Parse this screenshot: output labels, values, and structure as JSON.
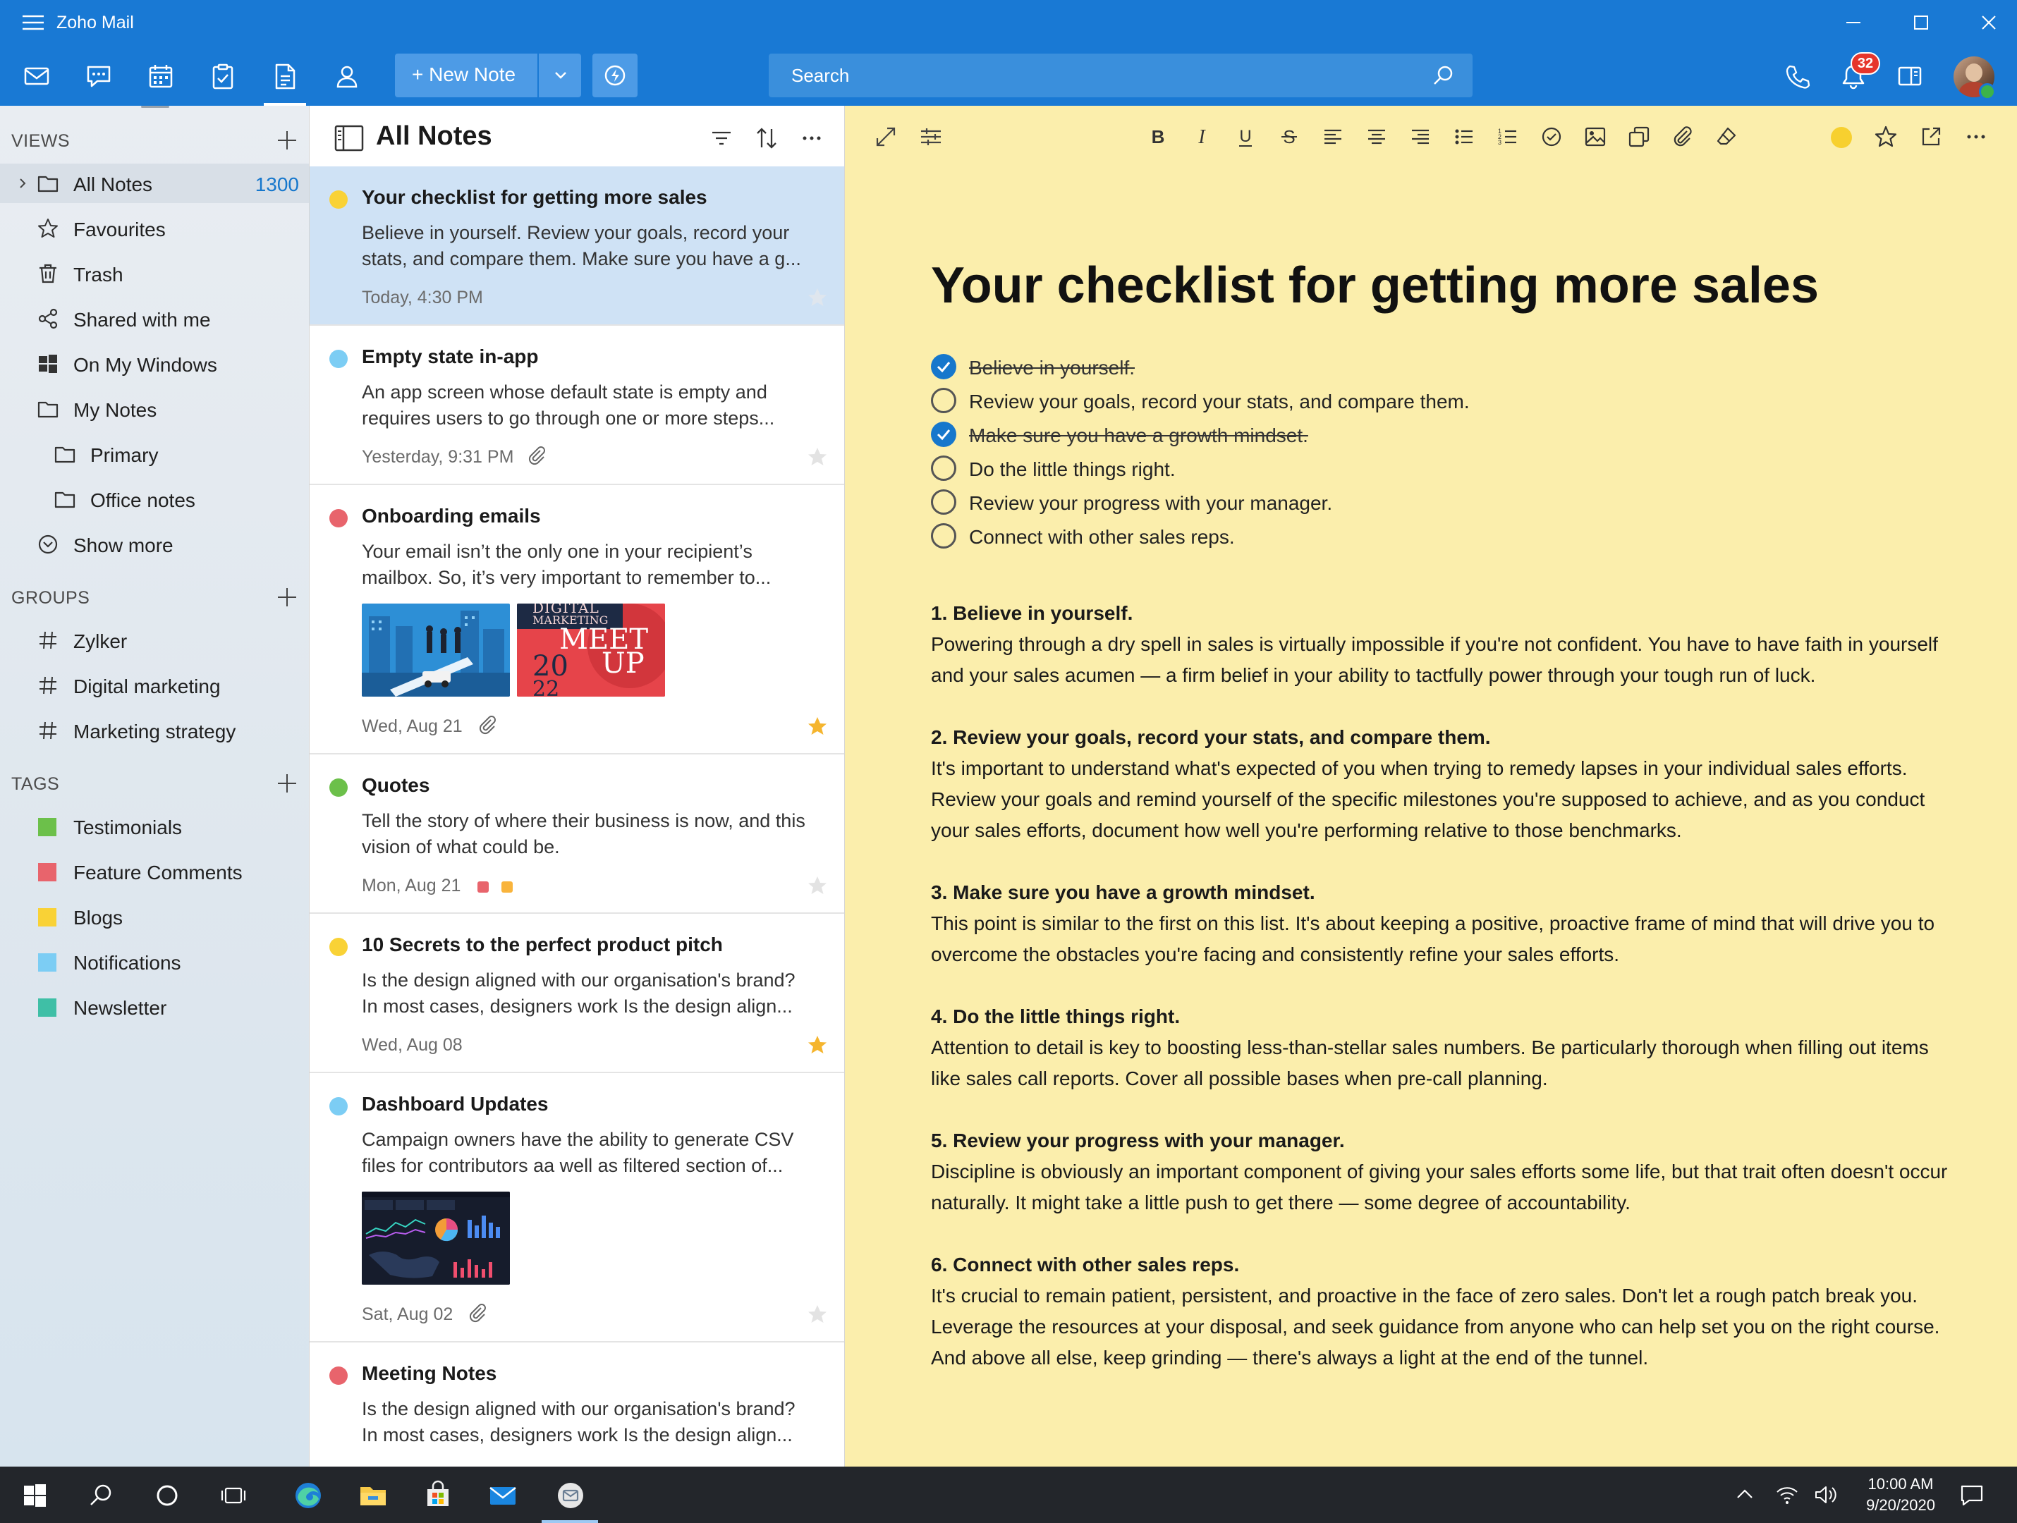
{
  "window": {
    "title": "Zoho Mail"
  },
  "toolbar": {
    "new_note_label": "New Note",
    "search_placeholder": "Search",
    "notification_count": "32"
  },
  "sidebar": {
    "views_heading": "VIEWS",
    "views": [
      {
        "label": "All Notes",
        "count": "1300",
        "icon": "folder-icon"
      },
      {
        "label": "Favourites",
        "icon": "star-icon"
      },
      {
        "label": "Trash",
        "icon": "trash-icon"
      },
      {
        "label": "Shared with me",
        "icon": "share-icon"
      },
      {
        "label": "On My Windows",
        "icon": "windows-icon"
      },
      {
        "label": "My Notes",
        "icon": "folder-icon"
      },
      {
        "label": "Primary",
        "icon": "folder-icon"
      },
      {
        "label": "Office notes",
        "icon": "folder-icon"
      },
      {
        "label": "Show more",
        "icon": "chevron-down-circle-icon"
      }
    ],
    "groups_heading": "GROUPS",
    "groups": [
      {
        "label": "Zylker"
      },
      {
        "label": "Digital marketing"
      },
      {
        "label": "Marketing strategy"
      }
    ],
    "tags_heading": "TAGS",
    "tags": [
      {
        "label": "Testimonials",
        "color": "#6cc04a"
      },
      {
        "label": "Feature Comments",
        "color": "#e8646c"
      },
      {
        "label": "Blogs",
        "color": "#f9d236"
      },
      {
        "label": "Notifications",
        "color": "#7ccdf4"
      },
      {
        "label": "Newsletter",
        "color": "#3fbfa6"
      }
    ]
  },
  "list": {
    "title": "All Notes",
    "notes": [
      {
        "title": "Your checklist for getting more sales",
        "preview": "Believe in yourself. Review your goals, record your stats, and compare them. Make sure you have a g...",
        "date": "Today, 4:30 PM",
        "color": "#f9d236",
        "starred": false,
        "selected": true
      },
      {
        "title": "Empty state in-app",
        "preview": "An app screen whose default state is empty and requires users to go through one or more steps...",
        "date": "Yesterday, 9:31 PM",
        "color": "#7ccdf4",
        "starred": false
      },
      {
        "title": "Onboarding emails",
        "preview": "Your email isn’t the only one in your recipient’s mailbox.  So, it’s very important to remember to...",
        "date": "Wed, Aug 21",
        "color": "#e8646c",
        "starred": true,
        "thumb_text": {
          "l1": "DIGITAL",
          "l2": "MARKETING",
          "l3": "MEET",
          "l4": "20",
          "l5": "UP",
          "l6": "22"
        }
      },
      {
        "title": "Quotes",
        "preview": "Tell the story of where their business is now, and this vision of what could be.",
        "date": "Mon, Aug 21",
        "color": "#6cc04a",
        "starred": false,
        "tag_colors": [
          "#e8646c",
          "#f9b43c"
        ]
      },
      {
        "title": "10 Secrets to the perfect product pitch",
        "preview": "Is the design aligned with our organisation's brand? In most cases, designers work Is the design align...",
        "date": "Wed, Aug 08",
        "color": "#f9d236",
        "starred": true
      },
      {
        "title": "Dashboard Updates",
        "preview": "Campaign owners have the ability to generate CSV files for contributors aa well as filtered section of...",
        "date": "Sat, Aug 02",
        "color": "#7ccdf4",
        "starred": false
      },
      {
        "title": "Meeting Notes",
        "preview": "Is the design aligned with our organisation's brand? In most cases, designers work Is the design align...",
        "color": "#e8646c"
      }
    ]
  },
  "editor": {
    "title": "Your checklist for getting more sales",
    "checklist": [
      {
        "text": "Believe in yourself.",
        "done": true
      },
      {
        "text": "Review your goals, record your stats, and compare them.",
        "done": false
      },
      {
        "text": "Make sure you have a growth mindset.",
        "done": true
      },
      {
        "text": "Do the little things right.",
        "done": false
      },
      {
        "text": "Review your progress with your manager.",
        "done": false
      },
      {
        "text": "Connect with other sales reps.",
        "done": false
      }
    ],
    "sections": [
      {
        "heading": "1. Believe in yourself.",
        "body": "Powering through a dry spell in sales is virtually impossible if you're not confident. You have to have faith in yourself and your sales acumen — a firm belief in your ability to tactfully power through your tough run of luck."
      },
      {
        "heading": "2. Review your goals, record your stats, and compare them.",
        "body": "It's important to understand what's expected of you when trying to remedy lapses in your individual sales efforts. Review your goals and remind yourself of the specific milestones you're supposed to achieve, and as you conduct your sales efforts, document how well you're performing relative to those benchmarks."
      },
      {
        "heading": "3. Make sure you have a growth mindset.",
        "body": "This point is similar to the first on this list. It's about keeping a positive, proactive frame of mind that will drive you to overcome the obstacles you're facing and consistently refine your sales efforts."
      },
      {
        "heading": "4. Do the little things right.",
        "body": "Attention to detail is key to boosting less-than-stellar sales numbers. Be particularly thorough when filling out items like sales call reports. Cover all possible bases when pre-call planning."
      },
      {
        "heading": "5. Review your progress with your manager.",
        "body": "Discipline is obviously an important component of giving your sales efforts some life, but that trait often doesn't occur naturally. It might take a little push to get there — some degree of accountability."
      },
      {
        "heading": "6. Connect with other sales reps.",
        "body": "It's crucial to remain patient, persistent, and proactive in the face of zero sales. Don't let a rough patch break you. Leverage the resources at your disposal, and seek guidance from anyone who can help set you on the right course. And above all else, keep grinding — there's always a light at the end of the tunnel."
      }
    ]
  },
  "taskbar": {
    "time": "10:00 AM",
    "date": "9/20/2020"
  },
  "colors": {
    "accent": "#1979d4",
    "note_bg": "#fbeeac",
    "selected_note": "#cfe2f5",
    "link": "#1677cc"
  }
}
